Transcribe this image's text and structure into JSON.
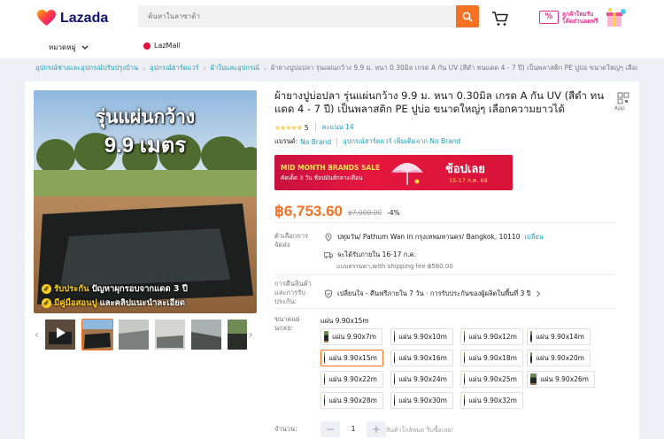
{
  "header": {
    "logo_text": "Lazada",
    "search_placeholder": "ค้นหาในลาซาด้า",
    "promo_pct": "%",
    "promo_text": "ลูกค้าใหม่รับ โค้ดส่วนลดฟรี"
  },
  "nav": {
    "categories_label": "หมวดหมู่",
    "lazmall_label": "LazMall"
  },
  "breadcrumb": {
    "items": [
      "อุปกรณ์ช่างและอุปกรณ์ปรับปรุงบ้าน",
      "อุปกรณ์ฮาร์ดแวร์",
      "ผ้าใบและอุปกรณ์"
    ],
    "current": "ผ้ายางปูบ่อปลา รุ่นแผ่นกว้าง 9.9 ม. หนา 0.30มิล เกรด A กัน UV (สีดำ ทนแดด 4 - 7 ปี) เป็นพลาสติก PE ปูบ่อ ขนาดใหญ่ๆ เลือก"
  },
  "gallery": {
    "main_title_1": "รุ่นแผ่นกว้าง",
    "main_title_2": "9.9 เมตร",
    "caption_1_highlight": "รับประกัน",
    "caption_1_rest": " ปัญหาผุกรอบจากแดด 3 ปี",
    "caption_2_highlight": "มีคู่มือสอนปู",
    "caption_2_rest": " และคลิปแนะนำละเอียด",
    "thumb_count": 6
  },
  "product": {
    "title": "ผ้ายางปูบ่อปลา รุ่นแผ่นกว้าง 9.9 ม. หนา 0.30มิล เกรด A กัน UV (สีดำ ทนแดด 4 - 7 ปี) เป็นพลาสติก PE ปูบ่อ ขนาดใหญ่ๆ เลือกความยาวได้",
    "share_label": "App",
    "stars": "★★★★★",
    "rating_value": "5",
    "rating_count_label": "คะแนน 14",
    "brand_label": "แบรนด์:",
    "brand_value": "No Brand",
    "brand_more": "อุปกรณ์ฮาร์ดแวร์ เพิ่มเติมจาก No Brand",
    "price": "฿6,753.60",
    "original_price": "฿7,000.00",
    "discount": "-4%"
  },
  "banner": {
    "title": "MID MONTH BRANDS SALE",
    "subtitle": "คัดเด็ด 3 วัน ช้อปมันส์กลางเดือน",
    "cta": "ช้อปเลย",
    "dates": "15-17 ก.ค. 68"
  },
  "delivery": {
    "label": "ตัวเลือกการจัดส่ง",
    "location": "ปทุมวัน/ Pathum Wan in กรุงเทพมหานคร/ Bangkok, 10110",
    "change": "เปลี่ยน",
    "eta": "จะได้รับภายใน 16-17 ก.ค.",
    "shipping": "แบบธรรมดา,with shipping fee ฿560.00"
  },
  "returns": {
    "label": "การคืนสินค้าและการรับประกัน:",
    "text": "เปลี่ยนใจ - คืนฟรีภายใน 7 วัน · การรับประกันของผู้ผลิตในพื้นที่ 3 ปี"
  },
  "size": {
    "label": "ขนาดแผ่นกxย:",
    "selected": "แผ่น 9.90x15m",
    "options": [
      "แผ่น 9.90x7m",
      "แผ่น 9.90x10m",
      "แผ่น 9.90x12m",
      "แผ่น 9.90x14m",
      "แผ่น 9.90x15m",
      "แผ่น 9.90x16m",
      "แผ่น 9.90x18m",
      "แผ่น 9.90x20m",
      "แผ่น 9.90x22m",
      "แผ่น 9.90x24m",
      "แผ่น 9.90x25m",
      "แผ่น 9.90x26m",
      "แผ่น 9.90x28m",
      "แผ่น 9.90x30m",
      "แผ่น 9.90x32m"
    ],
    "selected_index": 4
  },
  "quantity": {
    "label": "จำนวน:",
    "minus": "−",
    "value": "1",
    "plus": "+",
    "stock_note": "สินค้าใกล้หมด รีบซื้อเลย!"
  },
  "colors": {
    "accent": "#f57224",
    "link": "#1a9cb7",
    "discount_text": "#e0103a"
  }
}
